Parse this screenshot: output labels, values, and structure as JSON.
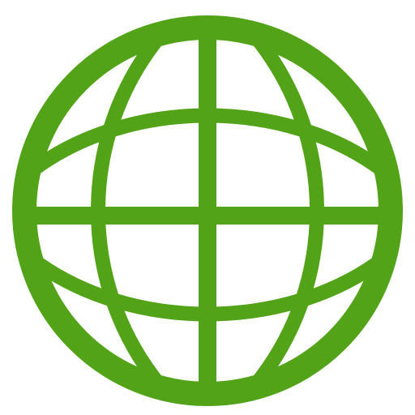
{
  "icon": {
    "name": "globe-icon",
    "color": "#53a318",
    "background": "#ffffff"
  }
}
